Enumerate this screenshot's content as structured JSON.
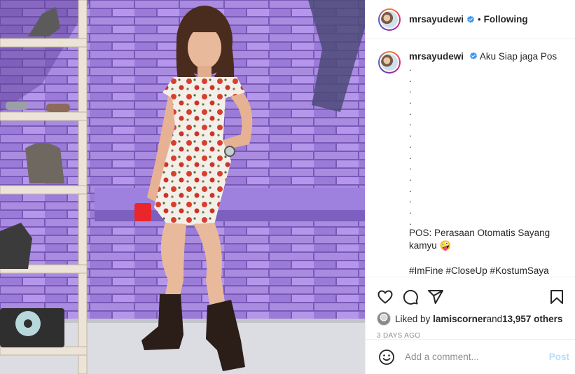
{
  "post": {
    "username": "mrsayudewi",
    "follow_status": "Following",
    "separator": "•"
  },
  "caption": {
    "username": "mrsayudewi",
    "headline": "Aku Siap jaga Pos",
    "dot_lines": [
      ".",
      ".",
      ".",
      ".",
      ".",
      ".",
      ".",
      ".",
      ".",
      ".",
      ".",
      ".",
      ".",
      ".",
      "."
    ],
    "body_line1": "POS: Perasaan Otomatis Sayang",
    "body_line2": "kamyu",
    "body_emoji": "🤪",
    "cut_line": "#ImFine #CloseUp #KostumSaya"
  },
  "likes": {
    "prefix": "Liked by ",
    "user": "lamiscorner",
    "mid": " and ",
    "count": "13,957 others"
  },
  "timestamp": "3 DAYS AGO",
  "comment_box": {
    "placeholder": "Add a comment...",
    "post_label": "Post"
  },
  "icons": {
    "like": "heart-icon",
    "comment": "comment-bubble-icon",
    "share": "paper-plane-icon",
    "save": "bookmark-icon",
    "emoji": "smiley-face-icon",
    "verified": "verified-badge-icon"
  },
  "colors": {
    "verified": "#3897f0",
    "post_disabled": "#b2dffc",
    "muted": "#8e8e8e"
  }
}
